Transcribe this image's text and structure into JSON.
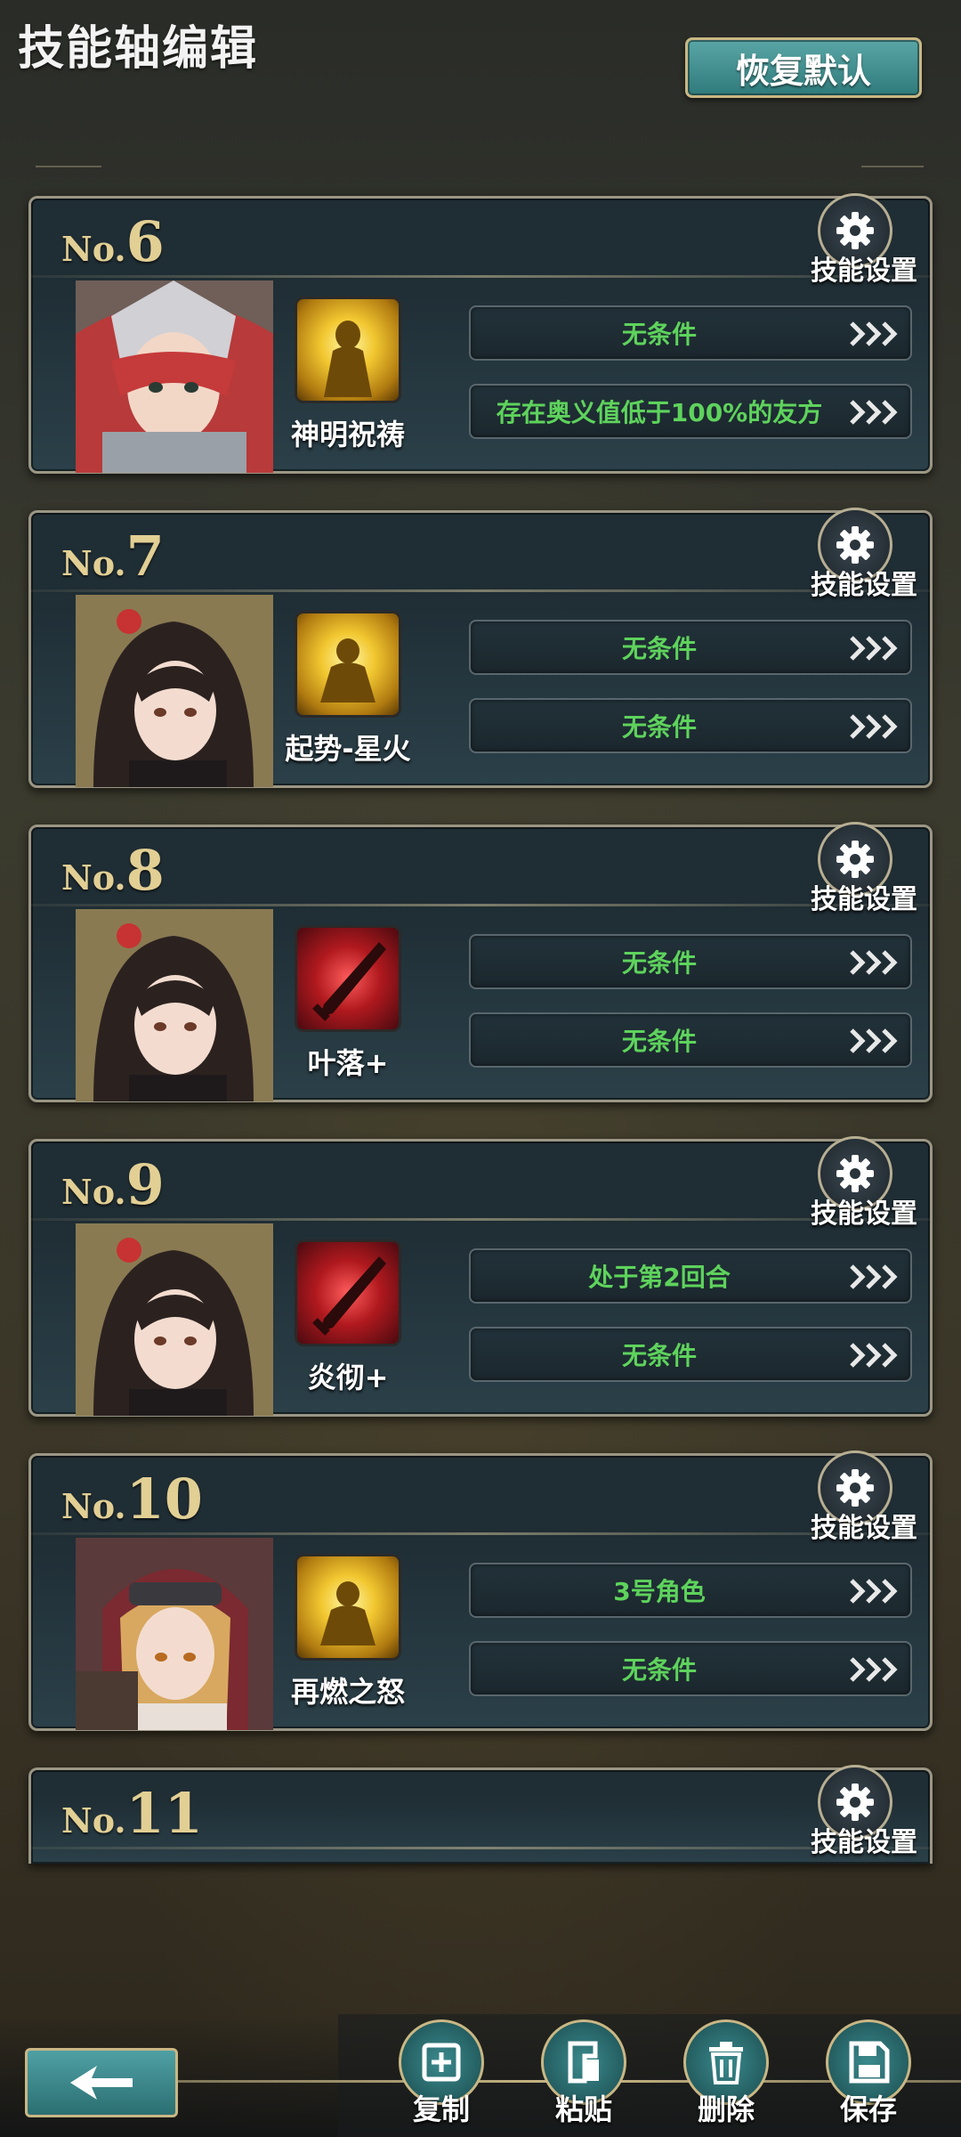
{
  "header": {
    "title": "技能轴编辑",
    "reset_label": "恢复默认"
  },
  "cards": [
    {
      "prefix": "No.",
      "number": "6",
      "settings_label": "技能设置",
      "skill_name": "神明祝祷",
      "icon": "gold-radiance-icon",
      "conditions": [
        "无条件",
        "存在奥义值低于100%的友方"
      ]
    },
    {
      "prefix": "No.",
      "number": "7",
      "settings_label": "技能设置",
      "skill_name": "起势-星火",
      "icon": "gold-warrior-icon",
      "conditions": [
        "无条件",
        "无条件"
      ]
    },
    {
      "prefix": "No.",
      "number": "8",
      "settings_label": "技能设置",
      "skill_name": "叶落+",
      "icon": "red-blade-icon",
      "conditions": [
        "无条件",
        "无条件"
      ]
    },
    {
      "prefix": "No.",
      "number": "9",
      "settings_label": "技能设置",
      "skill_name": "炎彻+",
      "icon": "red-blade-icon",
      "conditions": [
        "处于第2回合",
        "无条件"
      ]
    },
    {
      "prefix": "No.",
      "number": "10",
      "settings_label": "技能设置",
      "skill_name": "再燃之怒",
      "icon": "gold-warrior-icon",
      "conditions": [
        "3号角色",
        "无条件"
      ]
    },
    {
      "prefix": "No.",
      "number": "11",
      "settings_label": "技能设置"
    }
  ],
  "bottom": {
    "copy": "复制",
    "paste": "粘贴",
    "delete": "删除",
    "save": "保存"
  },
  "colors": {
    "condition_text": "#5ed35c",
    "number_gold": "#e2cf94",
    "accent_teal": "#3b8a8d"
  }
}
